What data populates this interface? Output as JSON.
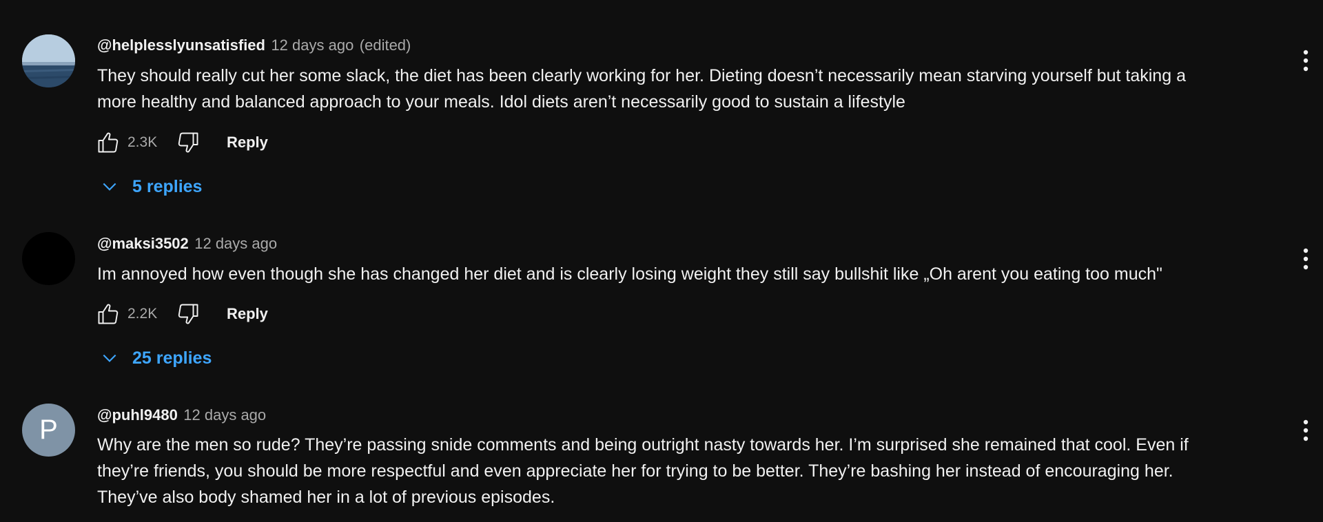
{
  "comments": [
    {
      "author": "@helplesslyunsatisfied",
      "time": "12 days ago",
      "edited": "(edited)",
      "lines": [
        "They should really cut her some slack, the diet has been clearly working for her. Dieting doesn’t necessarily mean starving yourself but taking a",
        "more healthy and balanced approach to your meals. Idol diets aren’t necessarily good to sustain a lifestyle"
      ],
      "likes": "2.3K",
      "reply_label": "Reply",
      "replies_label": "5 replies",
      "avatar_icon": "sea-horizon-photo"
    },
    {
      "author": "@maksi3502",
      "time": "12 days ago",
      "lines": [
        "Im annoyed how even though she has changed her diet and is clearly losing weight they still say bullshit like „Oh arent you eating too much\""
      ],
      "likes": "2.2K",
      "reply_label": "Reply",
      "replies_label": "25 replies",
      "avatar_icon": "black-circle"
    },
    {
      "author": "@puhl9480",
      "time": "12 days ago",
      "avatar_letter": "P",
      "lines": [
        "Why are the men so rude? They’re passing snide comments and being outright nasty towards her. I’m surprised she remained that cool. Even if",
        "they’re friends, you should be more respectful and even appreciate her for trying to be better. They’re bashing her instead of encouraging her.",
        "They’ve also body shamed her in a lot of previous episodes."
      ]
    }
  ],
  "colors": {
    "background": "#0f0f0f",
    "text": "#f1f1f1",
    "secondary_text": "#aaaaaa",
    "link_blue": "#3ea6ff",
    "avatar_letter_bg": "#7f93a6"
  }
}
